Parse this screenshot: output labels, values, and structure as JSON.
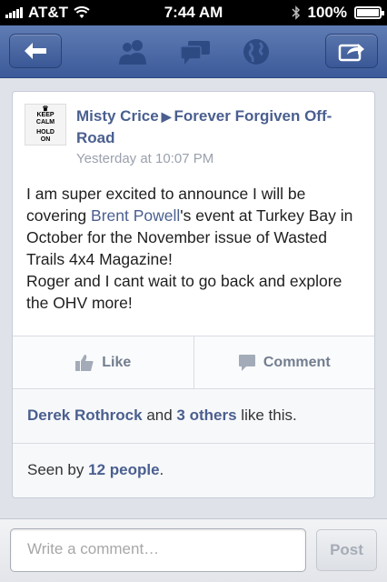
{
  "status_bar": {
    "carrier": "AT&T",
    "time": "7:44 AM",
    "battery": "100%",
    "battery_level": 1.0
  },
  "nav": {
    "back_icon": "back-arrow-icon",
    "center_icons": [
      "friends-icon",
      "messages-icon",
      "globe-icon"
    ],
    "share_icon": "share-icon"
  },
  "post": {
    "avatar_text": [
      "KEEP",
      "CALM",
      "HOLD",
      "ON"
    ],
    "author": "Misty Crice",
    "arrow": "▶",
    "target": "Forever Forgiven Off-Road",
    "timestamp": "Yesterday at 10:07 PM",
    "body": {
      "part1": "I am super excited to announce I will be covering ",
      "mention": "Brent Powell",
      "part2": "'s event at Turkey Bay in October for the November issue of Wasted Trails 4x4 Magazine!",
      "line2": "Roger and I cant wait to go back and explore the OHV more!"
    }
  },
  "actions": {
    "like": "Like",
    "comment": "Comment"
  },
  "likes": {
    "person": "Derek Rothrock",
    "and": " and ",
    "others": "3 others",
    "suffix": " like this."
  },
  "seen": {
    "prefix": "Seen by ",
    "count": "12 people",
    "suffix": "."
  },
  "comment_bar": {
    "placeholder": "Write a comment…",
    "post_label": "Post"
  },
  "colors": {
    "nav_blue": "#3c5a99",
    "link_blue": "#4a5f8f",
    "muted": "#9aa1ad"
  }
}
